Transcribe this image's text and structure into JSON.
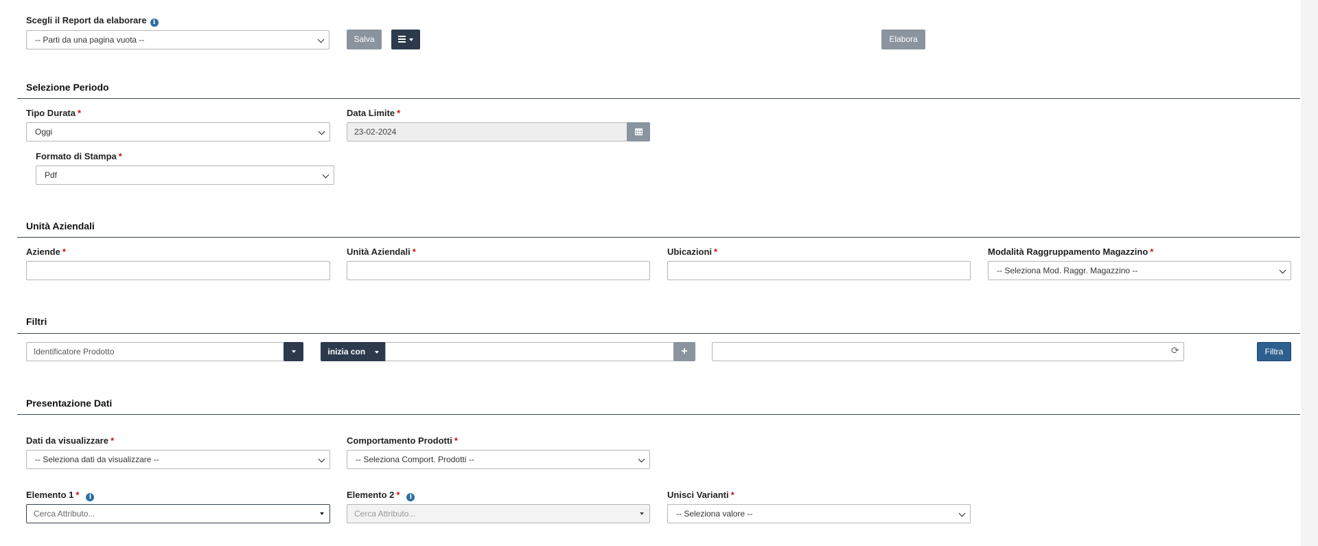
{
  "report": {
    "label": "Scegli il Report da elaborare",
    "select_value": "-- Parti da una pagina vuota --",
    "save_label": "Salva",
    "process_label": "Elabora"
  },
  "periodo": {
    "title": "Selezione Periodo",
    "tipo_durata_label": "Tipo Durata",
    "tipo_durata_value": "Oggi",
    "data_limite_label": "Data Limite",
    "data_limite_value": "23-02-2024",
    "formato_label": "Formato di Stampa",
    "formato_value": "Pdf"
  },
  "unita": {
    "title": "Unità Aziendali",
    "aziende_label": "Aziende",
    "unita_label": "Unità Aziendali",
    "ubicazioni_label": "Ubicazioni",
    "modalita_label": "Modalità Raggruppamento Magazzino",
    "modalita_value": "-- Seleziona Mod. Raggr. Magazzino --"
  },
  "filtri": {
    "title": "Filtri",
    "field_value": "Identificatore Prodotto",
    "operator_label": "inizia con",
    "filter_button": "Filtra",
    "plus": "+",
    "refresh": "⟳"
  },
  "presentazione": {
    "title": "Presentazione Dati",
    "dati_label": "Dati da visualizzare",
    "dati_value": "-- Seleziona dati da visualizzare --",
    "comportamento_label": "Comportamento Prodotti",
    "comportamento_value": "-- Seleziona Comport. Prodotti --",
    "elemento1_label": "Elemento 1",
    "elemento1_placeholder": "Cerca Attributo...",
    "elemento2_label": "Elemento 2",
    "elemento2_placeholder": "Cerca Attributo...",
    "unisci_label": "Unisci Varianti",
    "unisci_value": "-- Seleziona valore --"
  },
  "required_mark": "*",
  "info_mark": "i",
  "icons": {
    "info": "info-icon",
    "calendar": "calendar-icon",
    "menu": "menu-icon",
    "plus": "plus-icon",
    "refresh": "refresh-icon"
  },
  "colors": {
    "dark": "#2c3a4c",
    "grey_button": "#8a949e",
    "filter_button": "#2d5f8f",
    "required": "#cc1111",
    "info": "#2d6ea3"
  }
}
